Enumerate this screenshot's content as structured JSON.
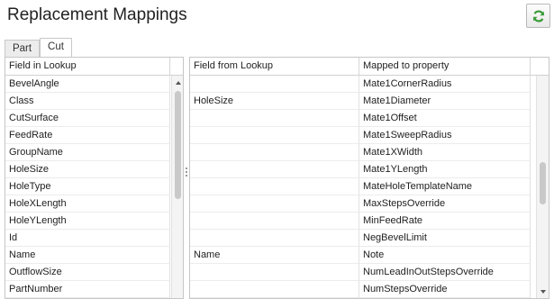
{
  "header": {
    "title": "Replacement Mappings"
  },
  "tabs": [
    {
      "label": "Part"
    },
    {
      "label": "Cut"
    }
  ],
  "left_grid": {
    "column": "Field in Lookup",
    "rows": [
      "BevelAngle",
      "Class",
      "CutSurface",
      "FeedRate",
      "GroupName",
      "HoleSize",
      "HoleType",
      "HoleXLength",
      "HoleYLength",
      "Id",
      "Name",
      "OutflowSize",
      "PartNumber"
    ]
  },
  "right_grid": {
    "columns": [
      "Field from Lookup",
      "Mapped to property"
    ],
    "rows": [
      [
        "",
        "Mate1CornerRadius"
      ],
      [
        "HoleSize",
        "Mate1Diameter"
      ],
      [
        "",
        "Mate1Offset"
      ],
      [
        "",
        "Mate1SweepRadius"
      ],
      [
        "",
        "Mate1XWidth"
      ],
      [
        "",
        "Mate1YLength"
      ],
      [
        "",
        "MateHoleTemplateName"
      ],
      [
        "",
        "MaxStepsOverride"
      ],
      [
        "",
        "MinFeedRate"
      ],
      [
        "",
        "NegBevelLimit"
      ],
      [
        "Name",
        "Note"
      ],
      [
        "",
        "NumLeadInOutStepsOverride"
      ],
      [
        "",
        "NumStepsOverride"
      ]
    ]
  },
  "colors": {
    "refresh_icon": "#3a9b3a",
    "border": "#c6c6c6"
  }
}
